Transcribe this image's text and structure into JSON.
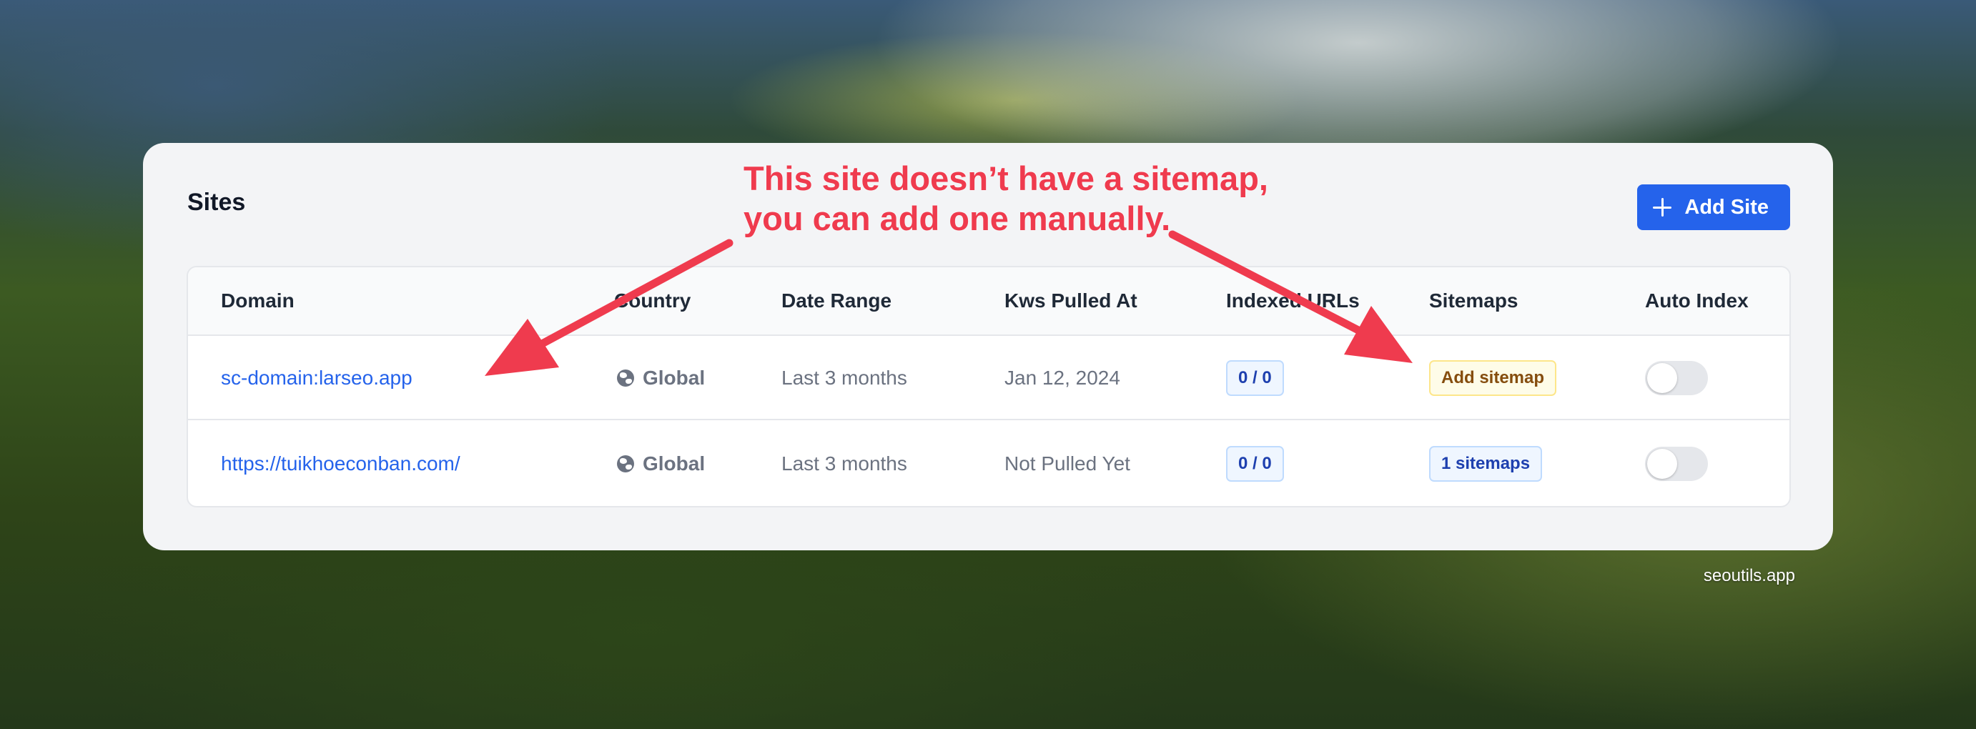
{
  "card": {
    "title": "Sites",
    "add_button_label": "Add Site"
  },
  "table": {
    "columns": [
      "Domain",
      "Country",
      "Date Range",
      "Kws Pulled At",
      "Indexed URLs",
      "Sitemaps",
      "Auto Index"
    ],
    "rows": [
      {
        "domain": "sc-domain:larseo.app",
        "country": "Global",
        "date_range": "Last 3 months",
        "kws_pulled_at": "Jan 12, 2024",
        "indexed_urls": "0 / 0",
        "sitemaps": "Add sitemap",
        "sitemaps_style": "warning",
        "auto_index": false
      },
      {
        "domain": "https://tuikhoeconban.com/",
        "country": "Global",
        "date_range": "Last 3 months",
        "kws_pulled_at": "Not Pulled Yet",
        "indexed_urls": "0 / 0",
        "sitemaps": "1 sitemaps",
        "sitemaps_style": "info",
        "auto_index": false
      }
    ]
  },
  "annotation": {
    "line1": "This site doesn’t have a sitemap,",
    "line2": "you can add one manually."
  },
  "watermark": "seoutils.app",
  "colors": {
    "primary": "#2563eb",
    "annotation": "#ef3b4e",
    "warning_badge_bg": "#fefce8",
    "info_badge_bg": "#eff6ff"
  },
  "icons": [
    "plus-icon",
    "globe-icon",
    "arrow-icon"
  ]
}
